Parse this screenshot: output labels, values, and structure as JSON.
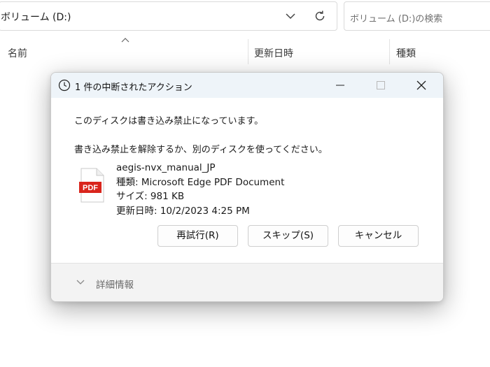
{
  "explorer": {
    "address": "ボリューム (D:)",
    "search_placeholder": "ボリューム (D:)の検索",
    "columns": [
      "名前",
      "更新日時",
      "種類"
    ]
  },
  "dialog": {
    "title": "1 件の中断されたアクション",
    "message1": "このディスクは書き込み禁止になっています。",
    "message2": "書き込み禁止を解除するか、別のディスクを使ってください。",
    "file": {
      "name": "aegis-nvx_manual_JP",
      "type_line": "種類: Microsoft Edge PDF Document",
      "size_line": "サイズ: 981 KB",
      "date_line": "更新日時: 10/2/2023 4:25 PM",
      "icon_label": "PDF"
    },
    "buttons": {
      "retry": "再試行(R)",
      "skip": "スキップ(S)",
      "cancel": "キャンセル"
    },
    "details_label": "詳細情報"
  }
}
